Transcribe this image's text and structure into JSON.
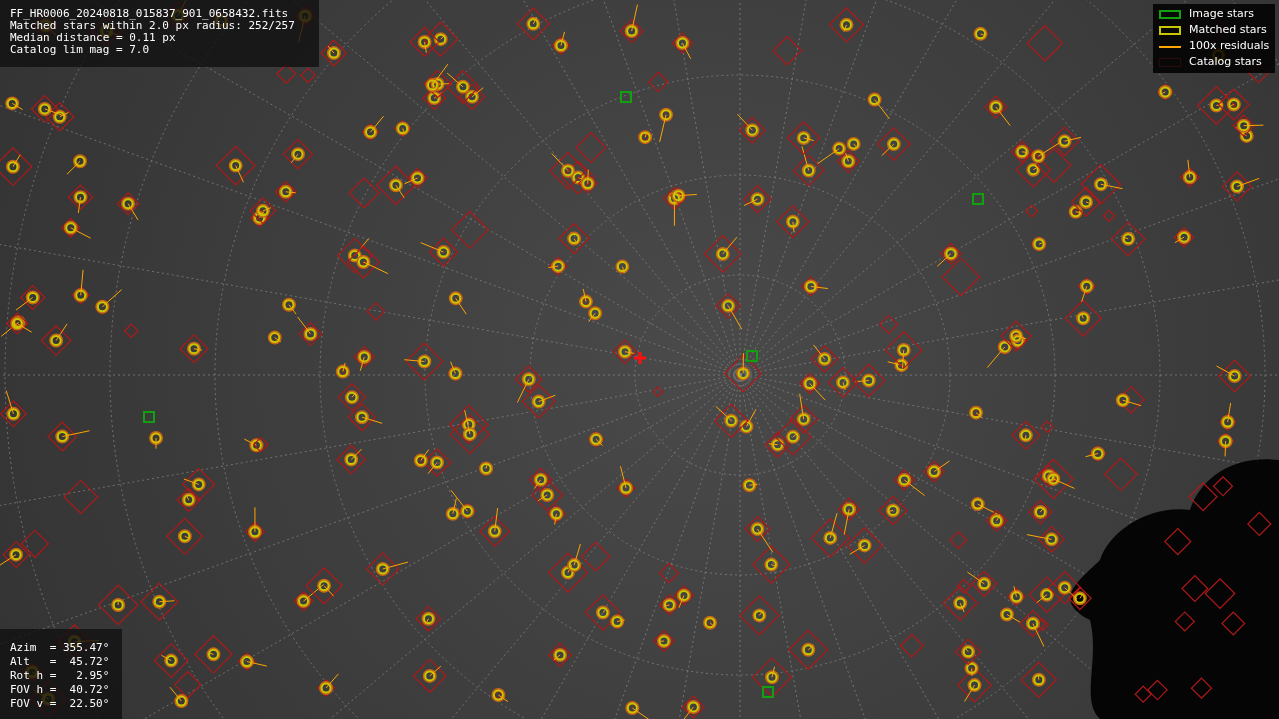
{
  "info_panel": {
    "lines": [
      "FF_HR0006_20240818_015837_901_0658432.fits",
      "Matched stars within 2.0 px radius: 252/257",
      "Median distance = 0.11 px",
      "Catalog lim mag = 7.0"
    ]
  },
  "legend": {
    "items": [
      {
        "kind": "image",
        "label": "Image stars"
      },
      {
        "kind": "matched",
        "label": "Matched stars"
      },
      {
        "kind": "residual",
        "label": "100x residuals"
      },
      {
        "kind": "catalog",
        "label": "Catalog stars"
      }
    ]
  },
  "pointing_panel": {
    "lines": [
      "Azim  = 355.47°",
      "Alt   =  45.72°",
      "Rot h =   2.95°",
      "FOV h =  40.72°",
      "FOV v =  22.50°"
    ]
  }
}
